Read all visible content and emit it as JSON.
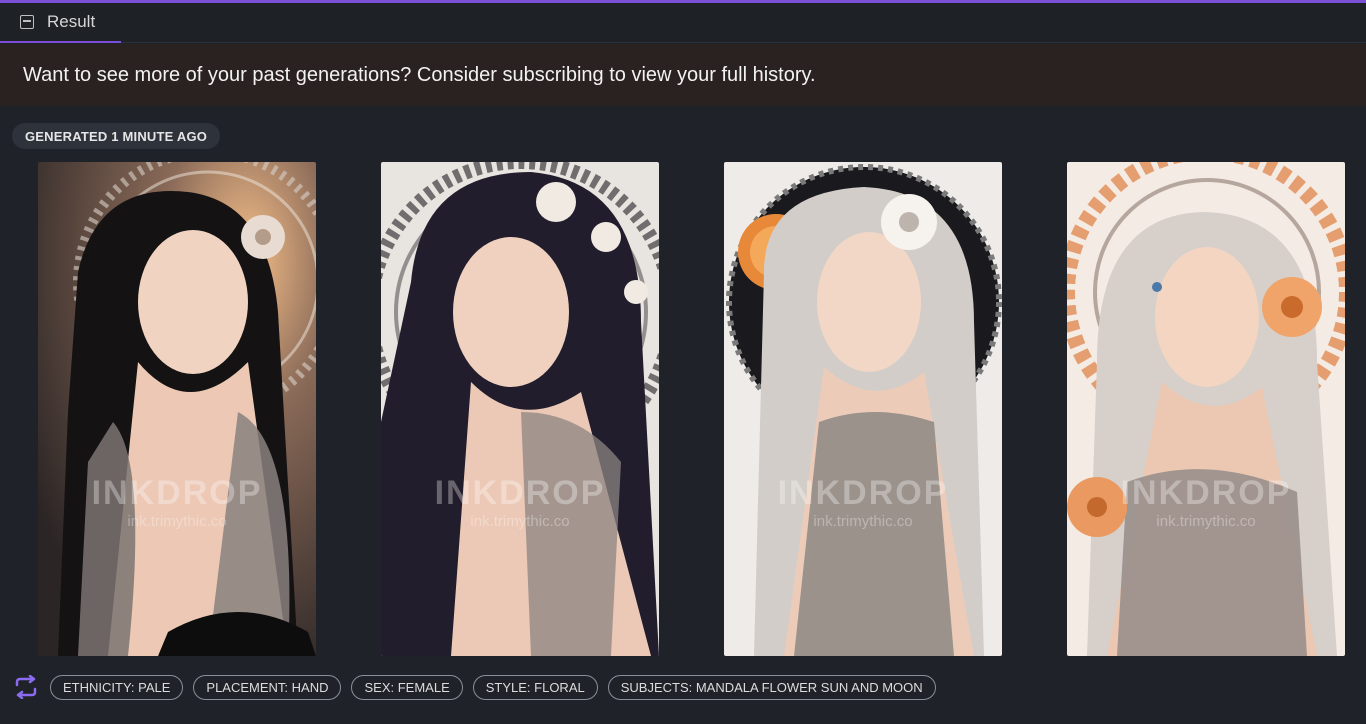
{
  "tab": {
    "label": "Result",
    "icon": "image-icon"
  },
  "banner": {
    "text": "Want to see more of your past generations? Consider subscribing to view your full history."
  },
  "generation": {
    "badge": "GENERATED 1 MINUTE AGO"
  },
  "images": [
    {
      "watermark": "INKDROP",
      "watermark_url": "ink.trimythic.co",
      "scheme": "dark-hair-warm-mandala"
    },
    {
      "watermark": "INKDROP",
      "watermark_url": "ink.trimythic.co",
      "scheme": "dark-hair-grey-mandala"
    },
    {
      "watermark": "INKDROP",
      "watermark_url": "ink.trimythic.co",
      "scheme": "silver-hair-sun-moon"
    },
    {
      "watermark": "INKDROP",
      "watermark_url": "ink.trimythic.co",
      "scheme": "silver-hair-orange-mandala"
    }
  ],
  "tags": {
    "regenerate_icon": "regenerate-icon",
    "items": [
      "ETHNICITY: PALE",
      "PLACEMENT: HAND",
      "SEX: FEMALE",
      "STYLE: FLORAL",
      "SUBJECTS: MANDALA FLOWER SUN AND MOON"
    ]
  },
  "colors": {
    "accent": "#7b4fd6",
    "background": "#1f2228",
    "banner": "#2a2220"
  }
}
